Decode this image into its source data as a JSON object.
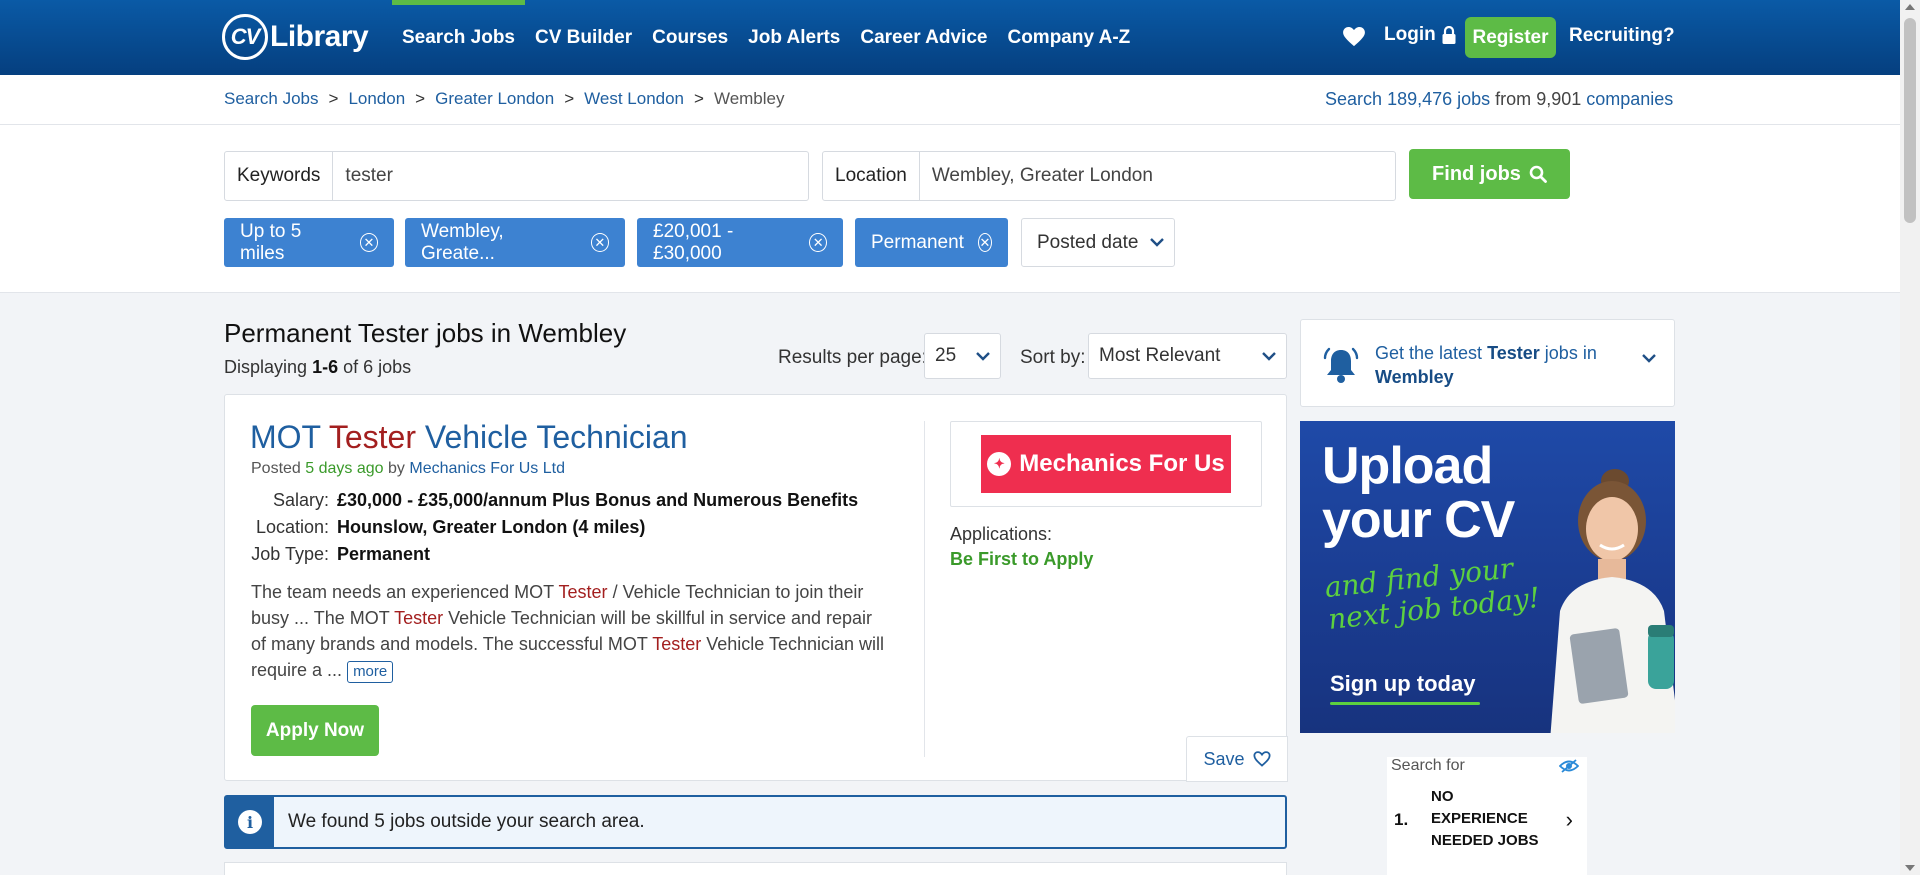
{
  "header": {
    "logo_cv": "CV",
    "logo_library": "Library",
    "nav": [
      "Search Jobs",
      "CV Builder",
      "Courses",
      "Job Alerts",
      "Career Advice",
      "Company A-Z"
    ],
    "active_nav": "Search Jobs",
    "login": "Login",
    "register": "Register",
    "recruiting": "Recruiting?"
  },
  "breadcrumb": {
    "items": [
      "Search Jobs",
      "London",
      "Greater London",
      "West London"
    ],
    "current": "Wembley",
    "sep": ">"
  },
  "stats": {
    "prefix": "Search",
    "jobs": "189,476 jobs",
    "from": "from",
    "companies_count": "9,901",
    "companies": "companies"
  },
  "search": {
    "keywords_label": "Keywords",
    "keywords_value": "tester",
    "location_label": "Location",
    "location_value": "Wembley, Greater London",
    "find_button": "Find jobs"
  },
  "filters": {
    "chips": [
      "Up to 5 miles",
      "Wembley, Greate...",
      "£20,001 - £30,000",
      "Permanent"
    ],
    "posted_date": "Posted date"
  },
  "results": {
    "title": "Permanent Tester jobs in Wembley",
    "displaying_prefix": "Displaying",
    "range": "1-6",
    "displaying_suffix": "of 6 jobs",
    "per_page_label": "Results per page:",
    "per_page_value": "25",
    "sort_label": "Sort by:",
    "sort_value": "Most Relevant"
  },
  "job": {
    "title_pre": "MOT",
    "title_hl": "Tester",
    "title_post": "Vehicle Technician",
    "posted_label": "Posted",
    "posted_ago": "5 days ago",
    "posted_by": "by",
    "company": "Mechanics For Us Ltd",
    "salary_label": "Salary:",
    "salary": "£30,000 - £35,000/annum Plus Bonus and Numerous Benefits",
    "location_label": "Location:",
    "location": "Hounslow, Greater London (4 miles)",
    "jobtype_label": "Job Type:",
    "jobtype": "Permanent",
    "desc_1": "The team needs an experienced MOT",
    "desc_hl": "Tester",
    "desc_2": "/ Vehicle Technician to join their busy ... The MOT",
    "desc_3": "Vehicle Technician will be skillful in service and repair of many brands and models. The successful MOT",
    "desc_4": "Vehicle Technician will require a ...",
    "more": "more",
    "apply": "Apply Now",
    "logo_text": "Mechanics For Us",
    "applications_label": "Applications:",
    "applications_value": "Be First to Apply",
    "save": "Save"
  },
  "notice": {
    "text": "We found 5 jobs outside your search area."
  },
  "sidebar": {
    "alert_pre": "Get the latest",
    "alert_keyword": "Tester",
    "alert_mid": "jobs in",
    "alert_location": "Wembley",
    "ad_line1": "Upload",
    "ad_line2": "your CV",
    "ad_line3": "and find your",
    "ad_line4": "next job today!",
    "ad_cta": "Sign up today",
    "search_for": "Search for",
    "sf_number": "1.",
    "sf_text": "NO EXPERIENCE NEEDED JOBS"
  },
  "colors": {
    "header_blue": "#0a5aa6",
    "green": "#5dbb46",
    "chip_blue": "#3d82d1",
    "link_blue": "#1f5fa0",
    "keyword_red": "#a31f1f"
  }
}
